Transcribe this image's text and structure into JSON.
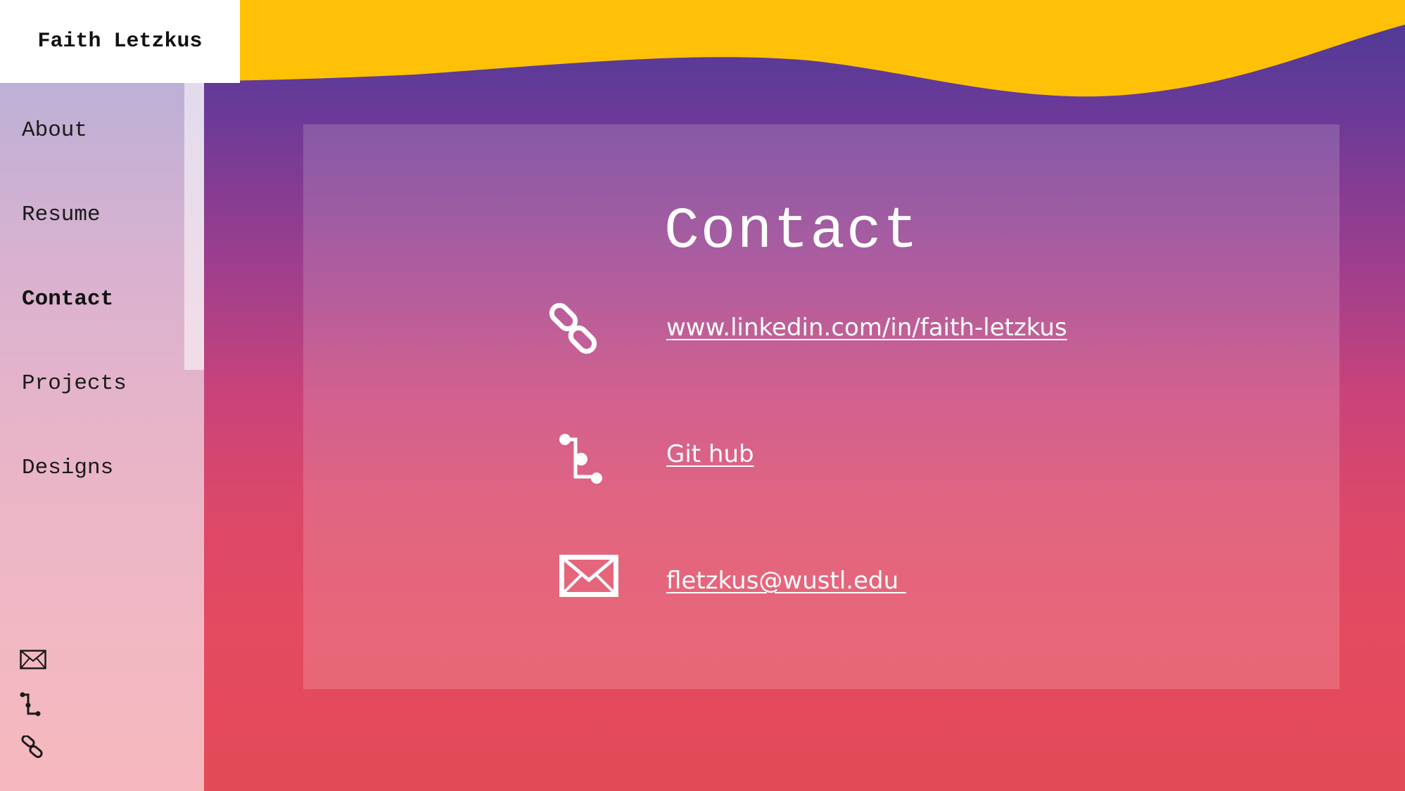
{
  "brand": {
    "name": "Faith Letzkus"
  },
  "nav": {
    "items": [
      {
        "label": "About"
      },
      {
        "label": "Resume"
      },
      {
        "label": "Contact",
        "active": true
      },
      {
        "label": "Projects"
      },
      {
        "label": "Designs"
      }
    ]
  },
  "sidebar_icons": [
    "mail-icon",
    "git-branch-icon",
    "link-icon"
  ],
  "main": {
    "title": "Contact",
    "links": [
      {
        "icon": "link-icon",
        "text": "www.linkedin.com/in/faith-letzkus"
      },
      {
        "icon": "git-branch-icon",
        "text": "Git hub"
      },
      {
        "icon": "mail-icon",
        "text": "fletzkus@wustl.edu "
      }
    ]
  },
  "colors": {
    "accent_yellow": "#ffc107",
    "gradient_top": "#4a3a96",
    "gradient_bottom": "#e34a57"
  }
}
